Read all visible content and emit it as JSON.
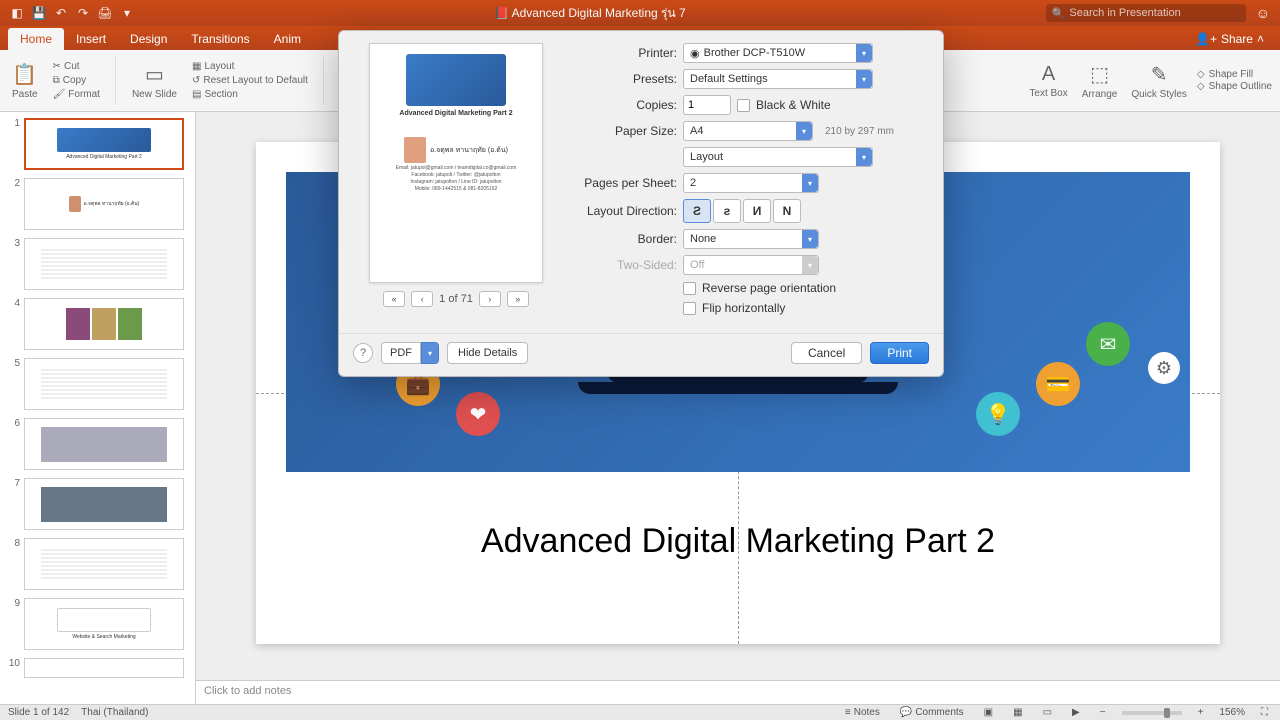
{
  "titlebar": {
    "doc_title": "Advanced Digital Marketing รุ่น 7",
    "search_placeholder": "Search in Presentation"
  },
  "tabs": {
    "items": [
      "Home",
      "Insert",
      "Design",
      "Transitions",
      "Anim"
    ],
    "active_index": 0,
    "share": "Share"
  },
  "ribbon": {
    "paste": "Paste",
    "cut": "Cut",
    "copy": "Copy",
    "format": "Format",
    "new_slide": "New Slide",
    "layout": "Layout",
    "reset": "Reset Layout to Default",
    "section": "Section",
    "text_box": "Text Box",
    "arrange": "Arrange",
    "quick_styles": "Quick Styles",
    "shape_fill": "Shape Fill",
    "shape_outline": "Shape Outline"
  },
  "thumbs": {
    "items": [
      {
        "num": "1",
        "caption": "Advanced Digital Marketing Part 2",
        "selected": true,
        "type": "hero"
      },
      {
        "num": "2",
        "caption": "อ.จตุพล ทานาฤทัย (อ.ต้น)",
        "type": "bio"
      },
      {
        "num": "3",
        "caption": "",
        "type": "text"
      },
      {
        "num": "4",
        "caption": "",
        "type": "photos"
      },
      {
        "num": "5",
        "caption": "",
        "type": "text"
      },
      {
        "num": "6",
        "caption": "",
        "type": "photo"
      },
      {
        "num": "7",
        "caption": "",
        "type": "photo"
      },
      {
        "num": "8",
        "caption": "",
        "type": "text"
      },
      {
        "num": "9",
        "caption": "Website & Search Marketing",
        "type": "hero"
      },
      {
        "num": "10",
        "caption": "",
        "type": "text"
      }
    ]
  },
  "slide": {
    "title": "Advanced Digital Marketing Part 2"
  },
  "notes": {
    "placeholder": "Click to add notes"
  },
  "statusbar": {
    "slide": "Slide 1 of 142",
    "lang": "Thai (Thailand)",
    "notes": "Notes",
    "comments": "Comments",
    "zoom": "156%"
  },
  "print": {
    "labels": {
      "printer": "Printer:",
      "presets": "Presets:",
      "copies": "Copies:",
      "bw": "Black & White",
      "paper_size": "Paper Size:",
      "section": "Layout",
      "pps": "Pages per Sheet:",
      "layout_dir": "Layout Direction:",
      "border": "Border:",
      "two_sided": "Two-Sided:",
      "reverse": "Reverse page orientation",
      "flip": "Flip horizontally",
      "pdf": "PDF",
      "hide": "Hide Details",
      "cancel": "Cancel",
      "print": "Print"
    },
    "values": {
      "printer": "Brother DCP-T510W",
      "presets": "Default Settings",
      "copies": "1",
      "paper_size": "A4",
      "paper_dim": "210 by 297 mm",
      "pps": "2",
      "border": "None",
      "two_sided": "Off"
    },
    "preview": {
      "title": "Advanced Digital Marketing Part 2",
      "name": "อ.จตุพล ทานาฤทัย (อ.ต้น)",
      "line1": "Email: jatupol@gmail.com / teamdigital.co@gmail.com",
      "line2": "Facebook: jatupolt   /   Twitter: @jatupolton",
      "line3": "Instagram: jatupolton   /   Line ID: jatupolton",
      "line4": "Mobile: 089-1442515 & 081-8205162",
      "pager": "1 of 71"
    }
  }
}
